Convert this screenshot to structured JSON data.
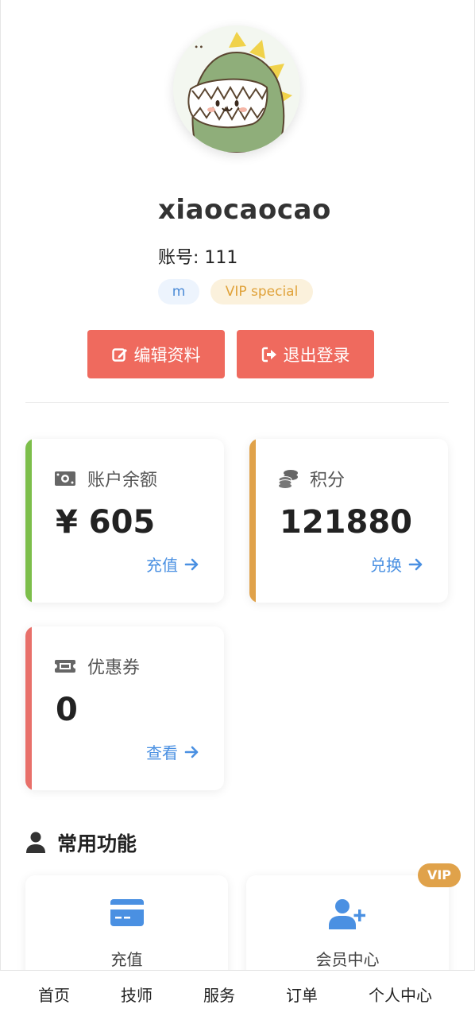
{
  "profile": {
    "username": "xiaocaocao",
    "account_label": "账号: 111",
    "tags": [
      "m",
      "VIP special"
    ]
  },
  "actions": {
    "edit_label": "编辑资料",
    "logout_label": "退出登录"
  },
  "stats": {
    "balance": {
      "title": "账户余额",
      "value": "¥ 605",
      "link": "充值",
      "accent": "#7cbe4a"
    },
    "points": {
      "title": "积分",
      "value": "121880",
      "link": "兑换",
      "accent": "#e0a24a"
    },
    "coupons": {
      "title": "优惠券",
      "value": "0",
      "link": "查看",
      "accent": "#e8706a"
    }
  },
  "features": {
    "title": "常用功能",
    "items": [
      {
        "label": "充值",
        "icon": "credit-card-icon"
      },
      {
        "label": "会员中心",
        "icon": "user-plus-icon",
        "badge": "VIP"
      }
    ]
  },
  "tabbar": {
    "items": [
      "首页",
      "技师",
      "服务",
      "订单",
      "个人中心"
    ]
  },
  "colors": {
    "primary_button": "#ef6a5e",
    "link": "#4a90e2",
    "vip_badge": "#e0a24a"
  }
}
